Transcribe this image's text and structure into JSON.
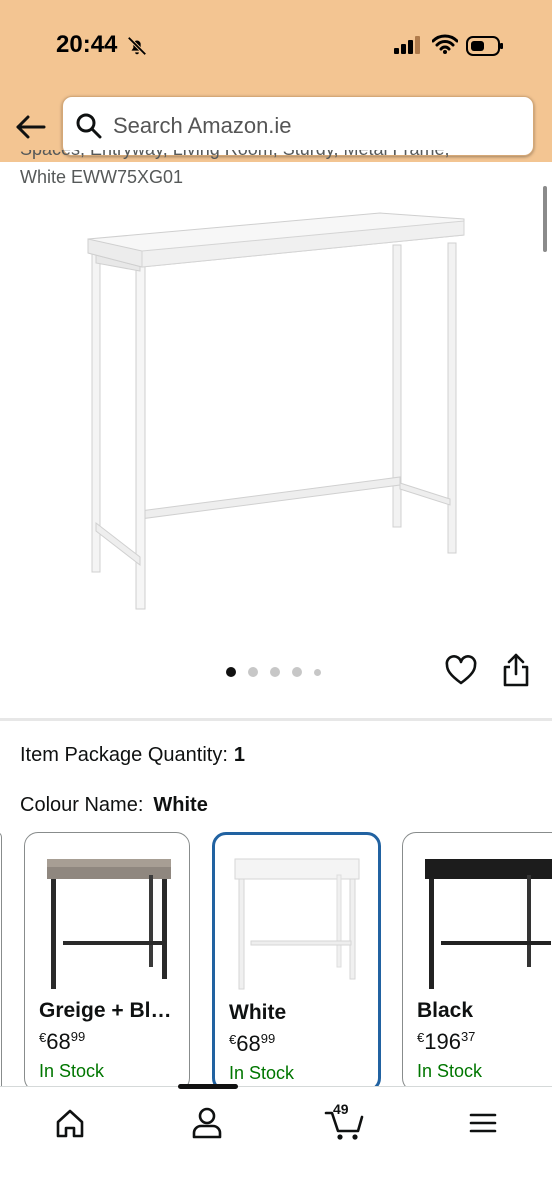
{
  "status_bar": {
    "time": "20:44"
  },
  "search": {
    "placeholder": "Search Amazon.ie"
  },
  "product": {
    "title_partial_line": "Spaces, Entryway, Living Room, Sturdy, Metal Frame,",
    "title_last_line": "White EWW75XG01",
    "carousel": {
      "dot_count": 5,
      "active_index": 0
    }
  },
  "options": {
    "quantity_label": "Item Package Quantity:",
    "quantity_value": "1",
    "colour_label": "Colour Name:",
    "colour_value": "White"
  },
  "swatches": [
    {
      "name": "Greige + Bl…",
      "currency": "€",
      "price_whole": "68",
      "price_fraction": "99",
      "stock": "In Stock",
      "selected": false
    },
    {
      "name": "White",
      "currency": "€",
      "price_whole": "68",
      "price_fraction": "99",
      "stock": "In Stock",
      "selected": true
    },
    {
      "name": "Black",
      "currency": "€",
      "price_whole": "196",
      "price_fraction": "37",
      "stock": "In Stock",
      "selected": false
    }
  ],
  "bottom_nav": {
    "cart_count": "49"
  },
  "colors": {
    "header": "#f3c592",
    "selected_border": "#2162a1",
    "in_stock": "#007600"
  }
}
